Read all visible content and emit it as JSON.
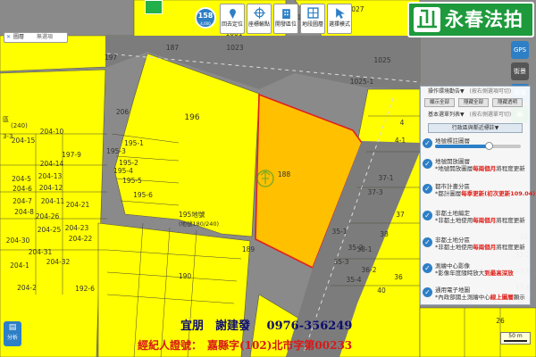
{
  "brand": {
    "name": "永春法拍",
    "logo_mark": "永春"
  },
  "badge": {
    "count": "158",
    "caption": "4,000"
  },
  "toolbar": {
    "buttons": [
      {
        "label": "回去定位"
      },
      {
        "label": "座標輸點"
      },
      {
        "label": "開發區位"
      },
      {
        "label": "地段圖層"
      },
      {
        "label": "選擇模式"
      }
    ],
    "locate_label": "定位"
  },
  "search": {
    "icon_label": "圖層",
    "value": "無選項"
  },
  "parcels": [
    {
      "label": "196"
    },
    {
      "label": "188"
    },
    {
      "label": "189"
    },
    {
      "label": "197"
    },
    {
      "label": "197-9"
    },
    {
      "label": "206"
    },
    {
      "label": "195-1"
    },
    {
      "label": "195-2"
    },
    {
      "label": "195-5"
    },
    {
      "label": "195-6"
    },
    {
      "label": "195-3"
    },
    {
      "label": "195-4"
    },
    {
      "label": "190"
    },
    {
      "label": "192-6"
    },
    {
      "label": "204-10"
    },
    {
      "label": "204-15"
    },
    {
      "label": "204-5"
    },
    {
      "label": "204-6"
    },
    {
      "label": "204-7"
    },
    {
      "label": "204-8"
    },
    {
      "label": "204-14"
    },
    {
      "label": "204-13"
    },
    {
      "label": "204-12"
    },
    {
      "label": "204-11"
    },
    {
      "label": "204-26"
    },
    {
      "label": "204-21"
    },
    {
      "label": "204-23"
    },
    {
      "label": "204-25"
    },
    {
      "label": "204-22"
    },
    {
      "label": "204-30"
    },
    {
      "label": "204-31"
    },
    {
      "label": "204-32"
    },
    {
      "label": "204-1"
    },
    {
      "label": "204-2"
    },
    {
      "label": "187"
    },
    {
      "label": "1023"
    },
    {
      "label": "1061"
    },
    {
      "label": "1025"
    },
    {
      "label": "1025-1"
    },
    {
      "label": "1024"
    },
    {
      "label": "1027"
    },
    {
      "label": "37-1"
    },
    {
      "label": "37-3"
    },
    {
      "label": "37"
    },
    {
      "label": "38"
    },
    {
      "label": "38-1"
    },
    {
      "label": "40"
    },
    {
      "label": "33"
    },
    {
      "label": "33-2"
    },
    {
      "label": "33-5"
    },
    {
      "label": "33-6"
    },
    {
      "label": "32-1"
    },
    {
      "label": "32-2"
    },
    {
      "label": "33-3"
    },
    {
      "label": "26"
    },
    {
      "label": "35-1"
    },
    {
      "label": "35-3"
    },
    {
      "label": "35-2"
    },
    {
      "label": "36"
    },
    {
      "label": "36-2"
    },
    {
      "label": "35-4"
    },
    {
      "label": "4"
    },
    {
      "label": "4-1"
    }
  ],
  "map_notes": {
    "left_line1": "區",
    "left_line2": "(240)",
    "left_line3": "3-3",
    "center_line1": "195地號",
    "center_line2": "(地號180/240)"
  },
  "panel": {
    "header_row1": "操作環境勸告▼",
    "header_row1_hint": "(按右側選項可切)",
    "btn_a": "顯示全部",
    "btn_b": "隱藏全部",
    "btn_c": "隱藏透明",
    "header_row2": "基本選單列表▼",
    "header_row2_hint": "(按右側選單可切)",
    "section_title": "行政區與鄰近標註▼",
    "layers": [
      {
        "label": "地號標註圖層",
        "sub": ""
      },
      {
        "label": "地號開放圖層",
        "sub_pre": "*地號開放圖層",
        "sub_red": "每兩個月",
        "sub_post": "將程度更新"
      },
      {
        "label": "都市計畫分區",
        "sub_pre": "*都計圖層",
        "sub_red": "每季更新(初次更新109.04)",
        "sub_post": ""
      },
      {
        "label": "非都土地編定",
        "sub_pre": "*非都土地使用",
        "sub_red": "每兩個月",
        "sub_post": "將程度更新"
      },
      {
        "label": "非都土地分區",
        "sub_pre": "*非都土地使用",
        "sub_red": "每兩個月",
        "sub_post": "將程度更新"
      },
      {
        "label": "測繪中心影像",
        "sub_pre": "*影像年度隨時放大",
        "sub_red": "到最高深放",
        "sub_post": ""
      },
      {
        "label": "通用電子地圖",
        "sub_pre": "*內政部國土測繪中心",
        "sub_red": "線上圖層",
        "sub_post": "顯示"
      }
    ]
  },
  "right_tools": [
    "GPS",
    "街景",
    "圖層"
  ],
  "bottom_left": {
    "label": "分析"
  },
  "footer": {
    "line1_name": "宜朋　謝建發",
    "line1_phone": "0976-356249",
    "line2": "經紀人證號：　嘉縣字(102)北市字第00233"
  },
  "scale": {
    "label": "50 m"
  },
  "colors": {
    "parcel_yellow": "#ffff00",
    "subject_orange": "#ffc000",
    "subject_outline": "#e02020",
    "road_gray": "#7c7c7c",
    "brand_green": "#1e9a3c",
    "panel_blue": "#2d7fc6",
    "footer_red": "#d81818"
  },
  "icons": {
    "search": "search-icon",
    "menu": "menu-icon",
    "gps": "gps-icon",
    "street": "street-view-icon",
    "layers": "layers-icon"
  }
}
